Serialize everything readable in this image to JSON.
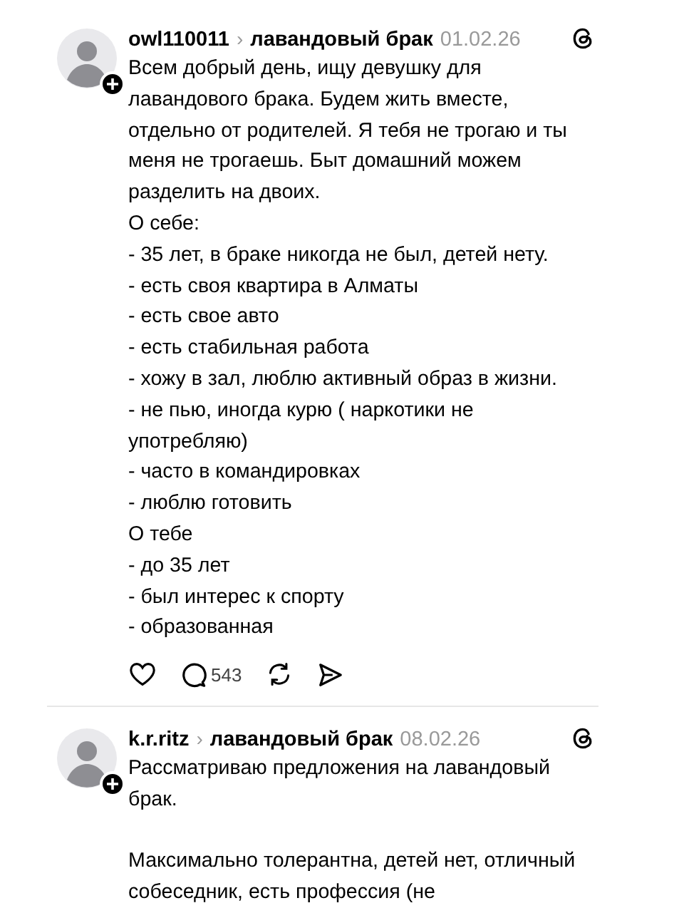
{
  "posts": [
    {
      "username": "owl110011",
      "separator": "›",
      "topic": "лавандовый брак",
      "date": "01.02.26",
      "paragraphs": [
        [
          "Всем добрый день, ищу девушку для лавандового брака. Будем жить вместе, отдельно от родителей. Я тебя не трогаю и ты меня не трогаешь. Быт домашний можем разделить на двоих.",
          "О себе:",
          "- 35 лет, в браке никогда не был, детей нету.",
          "- есть своя квартира в Алматы",
          "- есть свое авто",
          "- есть стабильная работа",
          "- хожу в зал, люблю активный образ в жизни.",
          "- не пью, иногда курю ( наркотики не употребляю)",
          "- часто в командировках",
          "- люблю готовить",
          "О тебе",
          "- до 35 лет",
          "- был интерес к спорту",
          "- образованная"
        ]
      ],
      "actions": {
        "comments": "543"
      }
    },
    {
      "username": "k.r.ritz",
      "separator": "›",
      "topic": "лавандовый брак",
      "date": "08.02.26",
      "paragraphs": [
        [
          "Рассматриваю предложения на лавандовый брак."
        ],
        [
          "Максимально толерантна, детей нет, отличный собеседник, есть профессия (не"
        ]
      ]
    }
  ]
}
